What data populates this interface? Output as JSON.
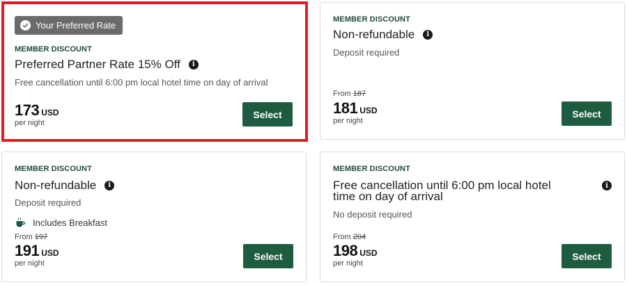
{
  "rates": [
    {
      "badge": "Your Preferred Rate",
      "tag": "MEMBER DISCOUNT",
      "title": "Preferred Partner Rate 15% Off",
      "subtitle": "Free cancellation until 6:00 pm local hotel time on day of arrival",
      "price": "173",
      "currency": "USD",
      "per_night": "per night",
      "select_label": "Select",
      "selected": true
    },
    {
      "tag": "MEMBER DISCOUNT",
      "title": "Non-refundable",
      "subtitle": "Deposit required",
      "from_label": "From",
      "original_price": "187",
      "price": "181",
      "currency": "USD",
      "per_night": "per night",
      "select_label": "Select"
    },
    {
      "tag": "MEMBER DISCOUNT",
      "title": "Non-refundable",
      "subtitle": "Deposit required",
      "amenity": "Includes Breakfast",
      "from_label": "From",
      "original_price": "197",
      "price": "191",
      "currency": "USD",
      "per_night": "per night",
      "select_label": "Select"
    },
    {
      "tag": "MEMBER DISCOUNT",
      "title_line1": "Free cancellation until 6:00 pm local hotel",
      "title_line2": "time on day of arrival",
      "subtitle": "No deposit required",
      "from_label": "From",
      "original_price": "204",
      "price": "198",
      "currency": "USD",
      "per_night": "per night",
      "select_label": "Select"
    }
  ],
  "icons": {
    "info": "info-icon",
    "check": "check-circle-icon",
    "breakfast": "coffee-cup-icon"
  },
  "colors": {
    "accent_green": "#1e5c40",
    "tag_green": "#1f4a35",
    "selected_border": "#e31b23",
    "badge_gray": "#6b6b6b"
  }
}
